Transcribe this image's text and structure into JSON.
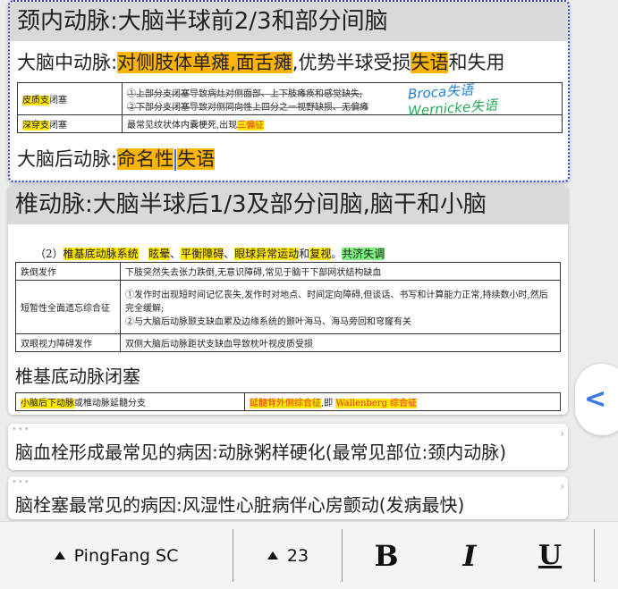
{
  "card1": {
    "header": "颈内动脉:大脑半球前2/3和部分间脑",
    "mca": {
      "prefix": "大脑中动脉:",
      "hl1": "对侧肢体单瘫,面舌瘫",
      "mid": ",优势半球受损",
      "hl2": "失语",
      "suffix": "和失用"
    },
    "table": {
      "rows": [
        {
          "label_a": "皮质支",
          "label_b": "闭塞",
          "line1": "①上部分支闭塞导致病灶对侧面部、上下肢瘫痪和感觉缺失;",
          "line2": "②下部分支闭塞导致对侧同向性上四分之一视野缺损、无偏瘫"
        },
        {
          "label_a": "深穿支",
          "label_b": "闭塞",
          "line1": "最常见纹状体内囊梗死,出现",
          "hl": "三偏征"
        }
      ]
    },
    "handwriting": {
      "broca": "Broca失语",
      "wernicke": "Wernicke失语"
    },
    "pca": {
      "prefix": "大脑后动脉:",
      "hl_a": "命名性",
      "hl_b": "失语"
    }
  },
  "card2": {
    "header": "椎动脉:大脑半球后1/3及部分间脑,脑干和小脑",
    "subtitle": {
      "num": "（2）",
      "name": "椎基底动脉系统",
      "s1": "眩晕",
      "sep1": "、",
      "s2": "平衡障碍",
      "sep2": "、",
      "s3": "眼球异常运动",
      "and": "和",
      "s4": "复视",
      "dot": "。",
      "s5": "共济失调"
    },
    "table": {
      "rows": [
        {
          "label": "跌倒发作",
          "content": [
            "下肢突然失去张力跌倒,无意识障碍,常见于脑干下部网状结构缺血"
          ]
        },
        {
          "label": "短暂性全面遗忘综合征",
          "content": [
            "①发作时出现短时间记忆丧失,发作时对地点、时间定向障碍,但谈话、书写和计算能力正常,持续数小时,然后完全缓解;",
            "②与大脑后动脉颞支缺血累及边缘系统的颞叶海马、海马旁回和穹窿有关"
          ]
        },
        {
          "label": "双眼视力障碍发作",
          "content": [
            "双侧大脑后动脉距状支缺血导致枕叶视皮质受损"
          ]
        }
      ]
    },
    "basilar": "椎基底动脉闭塞",
    "basilar_table": {
      "c1_hl": "小脑后下动脉",
      "c1_rest": "或椎动脉延髓分支",
      "c2_hl1": "延髓背外侧综合征",
      "c2_mid": ",即 ",
      "c2_hl2": "Wallenberg 综合征"
    }
  },
  "card3": {
    "dots": "•••",
    "text": "脑血栓形成最常见的病因:动脉粥样硬化(最常见部位:颈内动脉)"
  },
  "card4": {
    "dots": "•••",
    "text": "脑栓塞最常见的病因:风湿性心脏病伴心房颤动(发病最快)"
  },
  "toolbar": {
    "font": "PingFang SC",
    "size": "23",
    "bold": "B",
    "italic": "I",
    "underline": "U"
  },
  "icons": {
    "side_handle": "chevron-left-icon",
    "expand": "chevron-right-icon"
  },
  "colors": {
    "orange_highlight": "#ffb400",
    "yellow_highlight": "#ffe600",
    "green_highlight": "#7cf07c",
    "selection_border": "#2838c8",
    "accent": "#3a7ae0"
  }
}
